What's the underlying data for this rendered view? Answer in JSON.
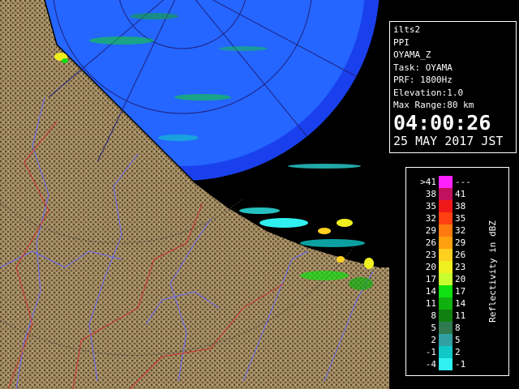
{
  "info": {
    "lines": [
      "ilts2",
      "PPI",
      "OYAMA_Z",
      "Task: OYAMA",
      "PRF: 1800Hz",
      "Elevation:1.0",
      "Max Range:80 km"
    ],
    "time": "04:00:26",
    "date": "25 MAY 2017 JST"
  },
  "legend": {
    "axis_label": "Reflectivity in dBZ",
    "rows": [
      {
        "low": ">41",
        "high": "---",
        "color": "#ff22ff"
      },
      {
        "low": "38",
        "high": "41",
        "color": "#c0105e"
      },
      {
        "low": "35",
        "high": "38",
        "color": "#f01818"
      },
      {
        "low": "32",
        "high": "35",
        "color": "#ff4010"
      },
      {
        "low": "29",
        "high": "32",
        "color": "#ff7a10"
      },
      {
        "low": "26",
        "high": "29",
        "color": "#ffa010"
      },
      {
        "low": "23",
        "high": "26",
        "color": "#ffd020"
      },
      {
        "low": "20",
        "high": "23",
        "color": "#f0f020"
      },
      {
        "low": "17",
        "high": "20",
        "color": "#c8ff30"
      },
      {
        "low": "14",
        "high": "17",
        "color": "#10e010"
      },
      {
        "low": "11",
        "high": "14",
        "color": "#10b010"
      },
      {
        "low": "8",
        "high": "11",
        "color": "#108010"
      },
      {
        "low": "5",
        "high": "8",
        "color": "#307a50"
      },
      {
        "low": "2",
        "high": "5",
        "color": "#30a0a0"
      },
      {
        "low": "-1",
        "high": "2",
        "color": "#10c8c8"
      },
      {
        "low": "-4",
        "high": "-1",
        "color": "#30f0f0"
      }
    ]
  },
  "colors": {
    "sea_outer": "#1a40ee",
    "sea_inner": "#2466ff",
    "land": "#a08a62",
    "land_dark": "#5a462a",
    "river": "#6a6aff",
    "boundary": "#d03030",
    "ring": "#202080"
  }
}
